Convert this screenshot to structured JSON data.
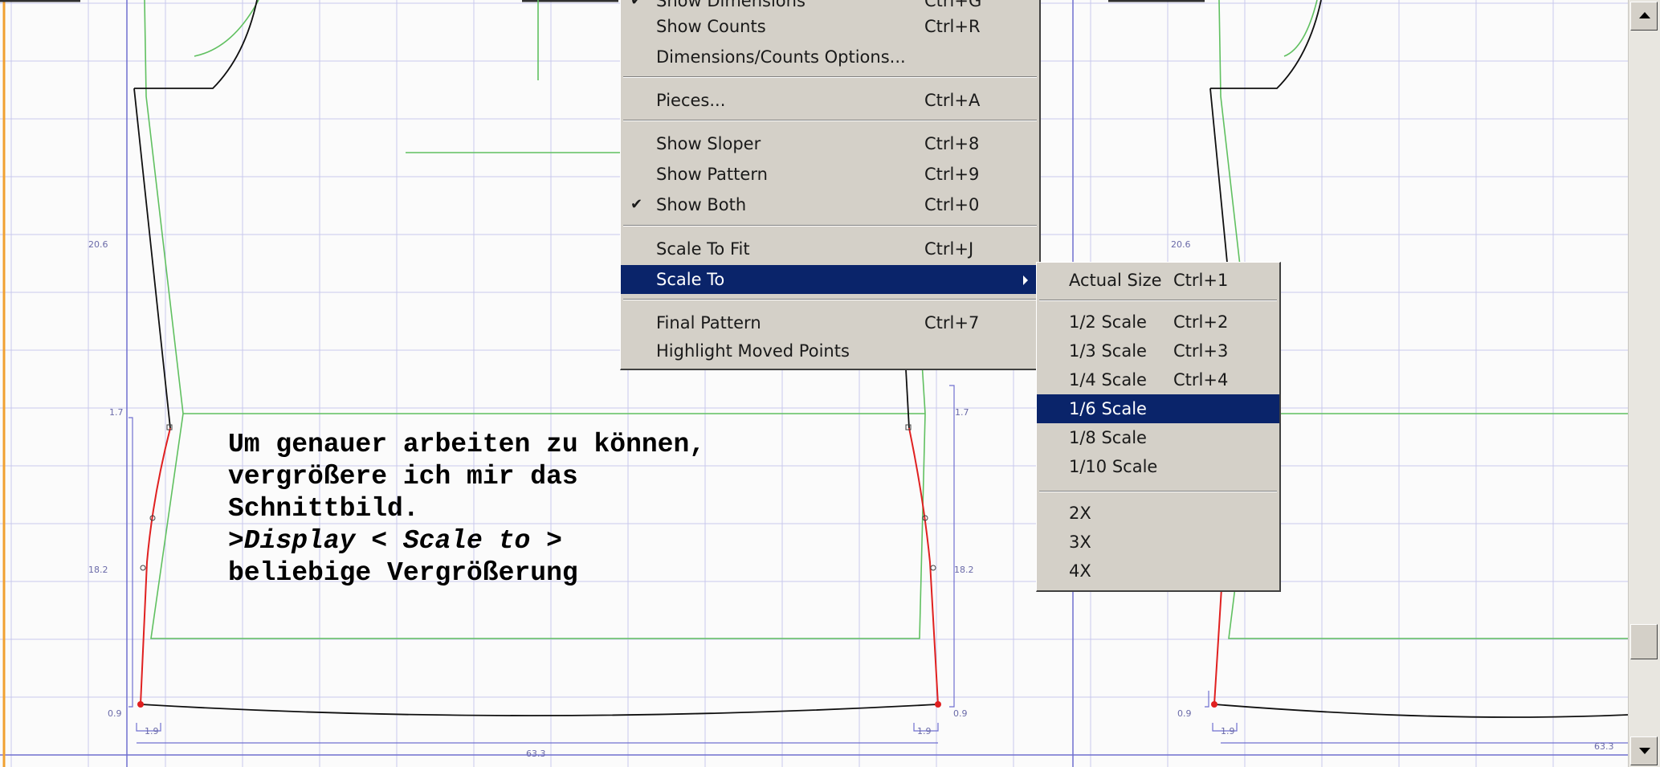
{
  "main_menu": {
    "items": [
      {
        "label": "Show Dimensions",
        "shortcut": "Ctrl+G",
        "checked": true
      },
      {
        "label": "Show Counts",
        "shortcut": "Ctrl+R",
        "checked": false
      },
      {
        "label": "Dimensions/Counts Options...",
        "shortcut": "",
        "checked": false
      },
      {
        "label": "Pieces...",
        "shortcut": "Ctrl+A",
        "checked": false
      },
      {
        "label": "Show Sloper",
        "shortcut": "Ctrl+8",
        "checked": false
      },
      {
        "label": "Show Pattern",
        "shortcut": "Ctrl+9",
        "checked": false
      },
      {
        "label": "Show Both",
        "shortcut": "Ctrl+0",
        "checked": true
      },
      {
        "label": "Scale To Fit",
        "shortcut": "Ctrl+J",
        "checked": false
      },
      {
        "label": "Scale To",
        "shortcut": "",
        "checked": false,
        "submenu": true,
        "highlighted": true
      },
      {
        "label": "Final Pattern",
        "shortcut": "Ctrl+7",
        "checked": false
      },
      {
        "label": "Highlight Moved Points",
        "shortcut": "",
        "checked": false
      }
    ],
    "check_mark": "✔"
  },
  "sub_menu": {
    "items": [
      {
        "label": "Actual Size",
        "shortcut": "Ctrl+1"
      },
      {
        "label": "1/2 Scale",
        "shortcut": "Ctrl+2"
      },
      {
        "label": "1/3 Scale",
        "shortcut": "Ctrl+3"
      },
      {
        "label": "1/4 Scale",
        "shortcut": "Ctrl+4"
      },
      {
        "label": "1/6 Scale",
        "shortcut": "",
        "highlighted": true
      },
      {
        "label": "1/8 Scale",
        "shortcut": ""
      },
      {
        "label": "1/10 Scale",
        "shortcut": ""
      },
      {
        "label": "2X",
        "shortcut": ""
      },
      {
        "label": "3X",
        "shortcut": ""
      },
      {
        "label": "4X",
        "shortcut": ""
      }
    ]
  },
  "caption": {
    "line1": "Um genauer arbeiten zu können,",
    "line2": "vergrößere ich mir das",
    "line3": "Schnittbild.",
    "line4": ">Display < Scale to >",
    "line5": "beliebige Vergrößerung"
  },
  "dimensions": {
    "left_upper": "20.6",
    "left_mid": "1.7",
    "left_lower": "18.2",
    "left_bottom": "0.9",
    "left_width": "1.9",
    "center_bottom": "63.3",
    "right_mid": "1.7",
    "right_lower": "18.2",
    "right_bottom": "0.9",
    "right_width": "1.9",
    "panel2_upper": "20.6",
    "panel2_bottom": "0.9",
    "panel2_width": "1.9",
    "panel2_corner": "63.3"
  },
  "colors": {
    "grid": "#c8c8ec",
    "axis": "#7070d0",
    "sloper": "#60c060",
    "pattern": "#101010",
    "moved": "#e02020",
    "menu_bg": "#d4d0c8",
    "highlight": "#0a246a"
  },
  "icons": {
    "scroll_up": "triangle-up-icon",
    "scroll_down": "triangle-down-icon",
    "submenu_arrow": "triangle-right-icon"
  }
}
